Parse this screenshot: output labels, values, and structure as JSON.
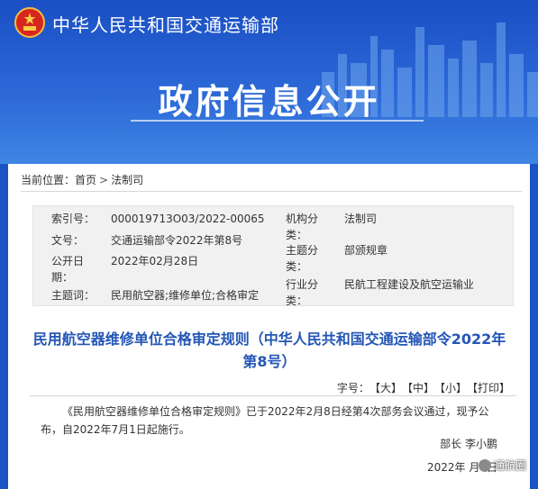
{
  "header": {
    "ministry_name": "中华人民共和国交通运输部",
    "page_title": "政府信息公开"
  },
  "breadcrumb": {
    "label": "当前位置：",
    "home": "首页",
    "separator": ">",
    "current": "法制司"
  },
  "meta": {
    "index_label": "索引号：",
    "index_value": "000019713O03/2022-00065",
    "doc_no_label": "文号：",
    "doc_no_value": "交通运输部令2022年第8号",
    "date_label": "公开日期：",
    "date_value": "2022年02月28日",
    "subject_label": "主题词：",
    "subject_value": "民用航空器;维修单位;合格审定",
    "org_label": "机构分类：",
    "org_value": "法制司",
    "topic_label": "主题分类：",
    "topic_value": "部颁规章",
    "industry_label": "行业分类：",
    "industry_value": "民航工程建设及航空运输业"
  },
  "document": {
    "title": "民用航空器维修单位合格审定规则（中华人民共和国交通运输部令2022年第8号）",
    "font_size_label": "字号：",
    "size_large": "【大】",
    "size_medium": "【中】",
    "size_small": "【小】",
    "print": "【打印】",
    "body": "《民用航空器维修单位合格审定规则》已于2022年2月8日经第4次部务会议通过，现予公布，自2022年7月1日起施行。",
    "signature": "部长 李小鹏",
    "sign_date": "2022年 月1日"
  },
  "watermark": {
    "text": "通航圈"
  },
  "colors": {
    "banner_blue": "#1a4fc4",
    "title_blue": "#2356b6"
  }
}
